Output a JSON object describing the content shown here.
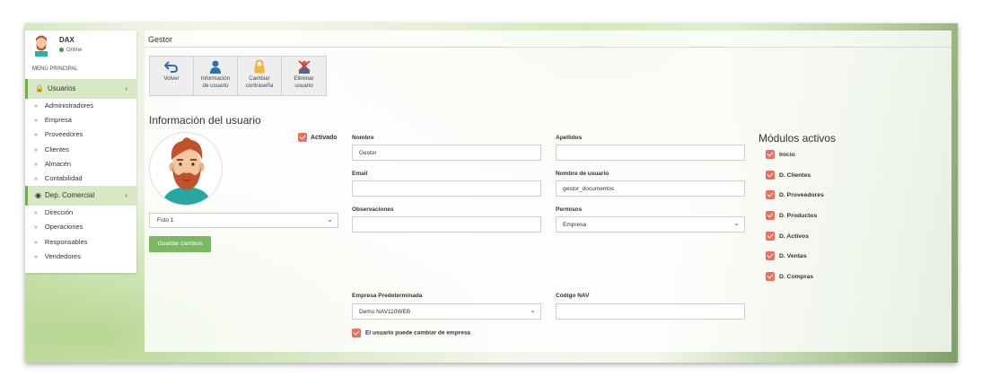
{
  "user": {
    "name": "DAX",
    "status": "Online"
  },
  "menu": {
    "title": "MENÚ PRINCIPAL",
    "groups": [
      {
        "label": "Usuarios",
        "icon": "lock-icon",
        "items": [
          "Administradores",
          "Empresa",
          "Proveedores",
          "Clientes",
          "Almacén",
          "Contabilidad"
        ]
      },
      {
        "label": "Dep. Comercial",
        "icon": "user-circle-icon",
        "items": [
          "Dirección",
          "Operaciones",
          "Responsables",
          "Vendedores"
        ]
      }
    ]
  },
  "page": {
    "title": "Gestor"
  },
  "toolbar": {
    "buttons": [
      {
        "label1": "Volver",
        "label2": "",
        "icon": "undo-icon"
      },
      {
        "label1": "Información",
        "label2": "de usuario",
        "icon": "user-icon"
      },
      {
        "label1": "Cambiar",
        "label2": "contraseña",
        "icon": "padlock-icon"
      },
      {
        "label1": "Eliminar",
        "label2": "usuario",
        "icon": "delete-user-icon"
      }
    ]
  },
  "form": {
    "section_title": "Información del usuario",
    "active_label": "Activado",
    "photo_select": "Foto 1",
    "save_label": "Guardar cambios",
    "nombre": {
      "label": "Nombre",
      "value": "Gestor"
    },
    "apellidos": {
      "label": "Apellidos",
      "value": ""
    },
    "email": {
      "label": "Email",
      "value": ""
    },
    "username": {
      "label": "Nombre de usuario",
      "value": "gestor_documentos"
    },
    "observaciones": {
      "label": "Observaciones",
      "value": ""
    },
    "permisos": {
      "label": "Permisos",
      "value": "Empresa"
    },
    "empresa_pred": {
      "label": "Empresa Predeterminada",
      "value": "Demo NAV110WEB"
    },
    "codigo_nav": {
      "label": "Código NAV",
      "value": ""
    },
    "change_company_label": "El usuario puede cambiar de empresa"
  },
  "modules": {
    "title": "Módulos activos",
    "items": [
      "Inicio",
      "D. Clientes",
      "D. Proveedores",
      "D. Productos",
      "D. Activos",
      "D. Ventas",
      "D. Compras"
    ]
  },
  "colors": {
    "accent_green": "#7ab963",
    "checkbox_red": "#ef6d5a",
    "sidebar_active": "#d9e8c4"
  }
}
